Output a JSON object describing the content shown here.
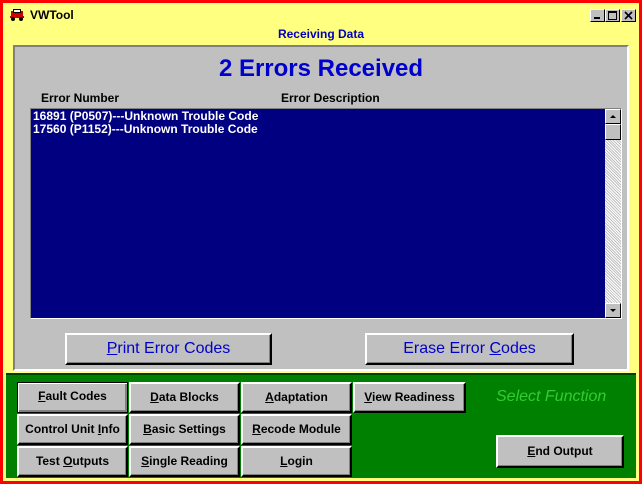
{
  "window": {
    "title": "VWTool"
  },
  "header": {
    "subtitle": "Receiving Data",
    "title": "2 Errors Received"
  },
  "errors": {
    "col_number": "Error Number",
    "col_description": "Error Description",
    "rows": [
      "16891 (P0507)---Unknown Trouble Code",
      "17560 (P1152)---Unknown Trouble Code"
    ]
  },
  "actions": {
    "print": {
      "before": "",
      "key": "P",
      "after": "rint Error Codes"
    },
    "erase": {
      "before": "Erase Error ",
      "key": "C",
      "after": "odes"
    }
  },
  "functions": {
    "status": "Select Function",
    "buttons": [
      {
        "before": "",
        "key": "F",
        "after": "ault Codes"
      },
      {
        "before": "",
        "key": "D",
        "after": "ata Blocks"
      },
      {
        "before": "",
        "key": "A",
        "after": "daptation"
      },
      {
        "before": "",
        "key": "V",
        "after": "iew Readiness"
      },
      {
        "before": "Control Unit ",
        "key": "I",
        "after": "nfo"
      },
      {
        "before": "",
        "key": "B",
        "after": "asic Settings"
      },
      {
        "before": "",
        "key": "R",
        "after": "ecode Module"
      },
      {
        "before": "Test ",
        "key": "O",
        "after": "utputs"
      },
      {
        "before": "",
        "key": "S",
        "after": "ingle Reading"
      },
      {
        "before": "",
        "key": "L",
        "after": "ogin"
      }
    ],
    "end_output": {
      "before": "",
      "key": "E",
      "after": "nd Output"
    }
  },
  "colors": {
    "frame": "#ff0000",
    "background": "#ffff80",
    "list": "#000080",
    "function_panel": "#008000",
    "accent_text": "#0000cc"
  }
}
